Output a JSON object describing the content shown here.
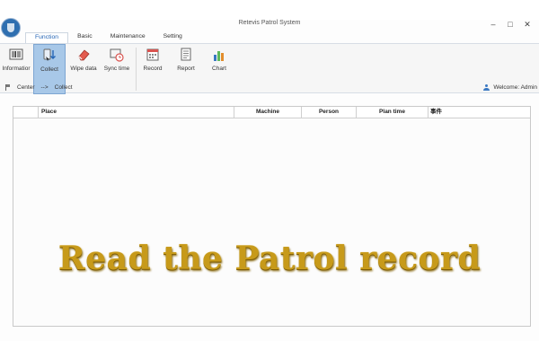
{
  "window": {
    "title": "Retevis Patrol System",
    "controls": [
      "–",
      "□",
      "✕"
    ]
  },
  "menu_tabs": [
    "Function",
    "Basic",
    "Maintenance",
    "Setting"
  ],
  "active_tab": "Function",
  "ribbon": {
    "buttons": [
      "Informatior",
      "Collect",
      "Wipe data",
      "Sync time",
      "Record",
      "Report",
      "Chart"
    ],
    "active": "Collect"
  },
  "breadcrumb": {
    "center": "Center",
    "arrow": "-->",
    "current": "Collect"
  },
  "welcome": "Welcome: Admin",
  "table": {
    "columns": [
      "Place",
      "Machine",
      "Person",
      "Plan time",
      "事件"
    ],
    "rows": []
  },
  "overlay_caption": "Read the Patrol record",
  "colors": {
    "accent": "#2565b5",
    "active_button": "#a8c8e8",
    "caption_gold": "#c79a1a"
  }
}
